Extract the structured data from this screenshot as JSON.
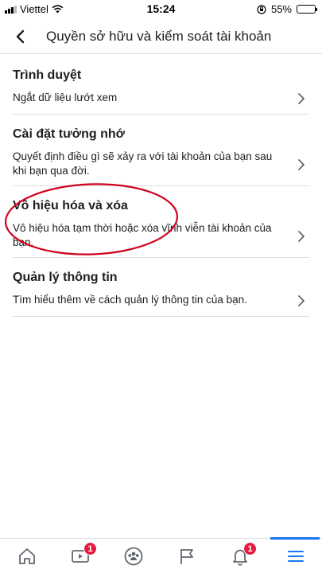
{
  "status_bar": {
    "carrier": "Viettel",
    "time": "15:24",
    "battery_percent": "55%",
    "battery_level": 0.55
  },
  "header": {
    "title": "Quyền sở hữu và kiểm soát tài khoản",
    "back_icon": "chevron-left-icon"
  },
  "sections": [
    {
      "title": "Trình duyệt",
      "description": "Ngắt dữ liệu lướt xem"
    },
    {
      "title": "Cài đặt tưởng nhớ",
      "description": "Quyết định điều gì sẽ xảy ra với tài khoản của bạn sau khi bạn qua đời."
    },
    {
      "title": "Vô hiệu hóa và xóa",
      "description": "Vô hiệu hóa tạm thời hoặc xóa vĩnh viễn tài khoản của bạn."
    },
    {
      "title": "Quản lý thông tin",
      "description": "Tìm hiểu thêm về cách quản lý thông tin của bạn."
    }
  ],
  "tabbar": {
    "tabs": [
      {
        "icon": "home-icon"
      },
      {
        "icon": "video-icon",
        "badge": "1"
      },
      {
        "icon": "groups-icon"
      },
      {
        "icon": "flag-icon"
      },
      {
        "icon": "bell-icon",
        "badge": "1"
      },
      {
        "icon": "menu-icon",
        "active": true
      }
    ]
  },
  "colors": {
    "accent": "#1877f2",
    "badge": "#e41e3f",
    "annotation": "#d0021b",
    "divider": "#dadde1"
  }
}
